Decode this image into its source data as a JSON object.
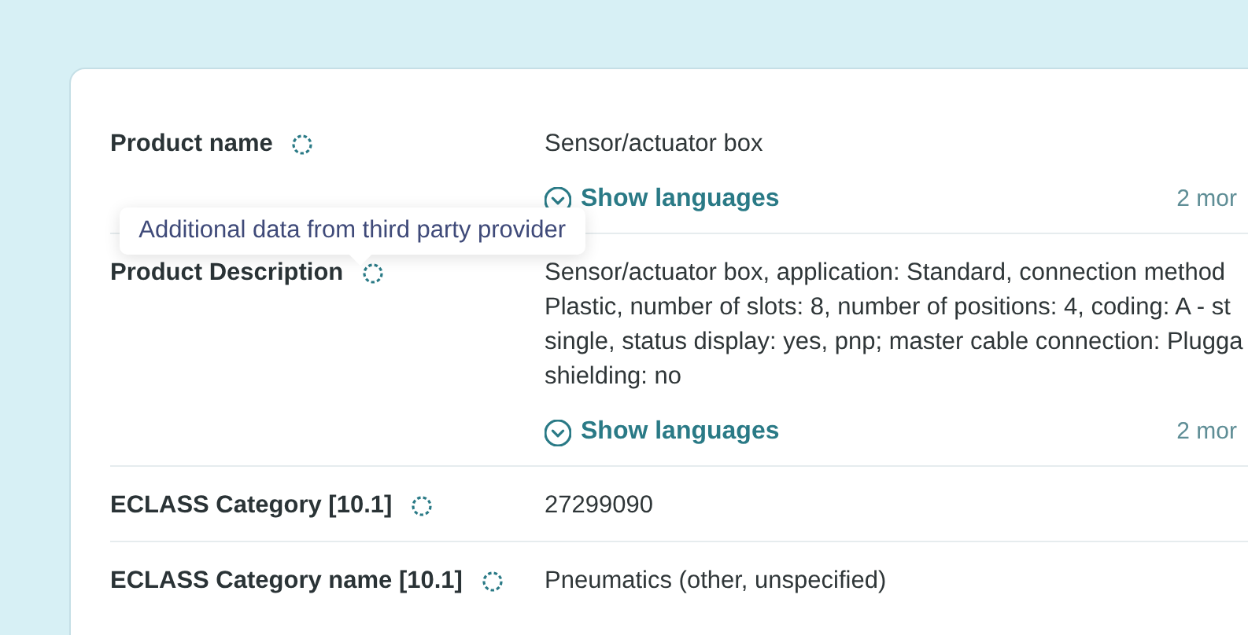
{
  "rows": [
    {
      "label": "Product name",
      "value_lines": [
        "Sensor/actuator box"
      ],
      "languages_link": "Show languages",
      "more": "2 mor",
      "tooltip": null
    },
    {
      "label": "Product Description",
      "value_lines": [
        "Sensor/actuator box, application: Standard, connection method",
        "Plastic, number of slots: 8, number of positions: 4, coding: A - st",
        "single, status display: yes, pnp; master cable connection: Plugga",
        "shielding: no"
      ],
      "languages_link": "Show languages",
      "more": "2 mor",
      "tooltip": "Additional data from third party provider"
    },
    {
      "label": "ECLASS Category  [10.1]",
      "value_lines": [
        "27299090"
      ],
      "languages_link": null,
      "more": null,
      "tooltip": null
    },
    {
      "label": "ECLASS Category name [10.1]",
      "value_lines": [
        "Pneumatics (other, unspecified)"
      ],
      "languages_link": null,
      "more": null,
      "tooltip": null
    }
  ]
}
